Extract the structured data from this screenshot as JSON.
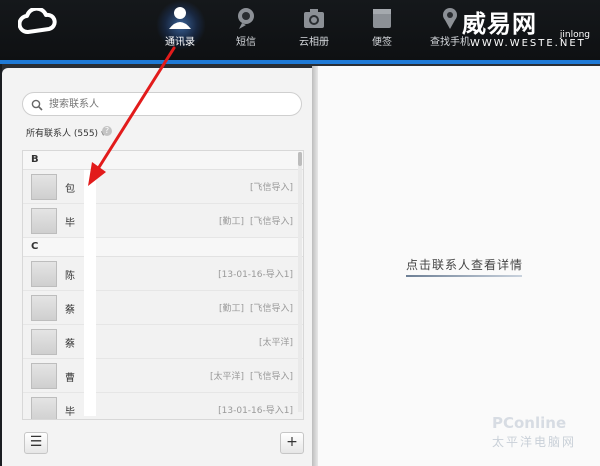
{
  "topnav": {
    "items": [
      {
        "label": "通讯录",
        "icon": "contacts-icon",
        "active": true
      },
      {
        "label": "短信",
        "icon": "sms-icon"
      },
      {
        "label": "云相册",
        "icon": "camera-icon"
      },
      {
        "label": "便签",
        "icon": "notes-icon"
      },
      {
        "label": "查找手机",
        "icon": "find-phone-icon"
      }
    ],
    "username": "jinlong"
  },
  "watermark_top": {
    "brand": "威易网",
    "url": "WWW.WESTE.NET"
  },
  "search": {
    "placeholder": "搜索联系人"
  },
  "filter": {
    "label": "所有联系人 (555)"
  },
  "contacts": {
    "sections": [
      {
        "letter": "B",
        "rows": [
          {
            "name": "包",
            "tags": [
              "[飞信导入]"
            ]
          },
          {
            "name": "毕",
            "tags": [
              "[勤工]",
              "[飞信导入]"
            ]
          }
        ]
      },
      {
        "letter": "C",
        "rows": [
          {
            "name": "陈",
            "tags": [
              "[13-01-16-导入1]"
            ]
          },
          {
            "name": "蔡",
            "tags": [
              "[勤工]",
              "[飞信导入]"
            ]
          },
          {
            "name": "蔡",
            "tags": [
              "[太平洋]"
            ]
          },
          {
            "name": "曹",
            "tags": [
              "[太平洋]",
              "[飞信导入]"
            ]
          },
          {
            "name": "毕",
            "tags": [
              "[13-01-16-导入1]"
            ]
          }
        ]
      }
    ]
  },
  "detail_hint": "点击联系人查看详情",
  "watermark_corner": {
    "line1": "PConline",
    "line2": "太平洋电脑网"
  },
  "colors": {
    "accent_blue": "#1f7ad6",
    "arrow_red": "#e21b1b"
  }
}
